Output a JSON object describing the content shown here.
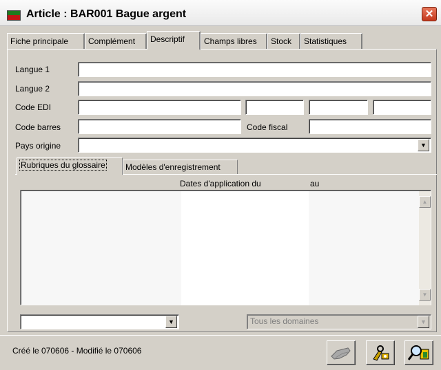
{
  "window": {
    "title": "Article : BAR001 Bague argent",
    "close_glyph": "✕"
  },
  "tabs": [
    {
      "label": "Fiche principale"
    },
    {
      "label": "Complément"
    },
    {
      "label": "Descriptif",
      "active": true
    },
    {
      "label": "Champs libres"
    },
    {
      "label": "Stock"
    },
    {
      "label": "Statistiques"
    }
  ],
  "form": {
    "langue1_label": "Langue 1",
    "langue1_value": "",
    "langue2_label": "Langue 2",
    "langue2_value": "",
    "code_edi_label": "Code EDI",
    "code_edi_values": [
      "",
      "",
      "",
      ""
    ],
    "code_barres_label": "Code barres",
    "code_barres_value": "",
    "code_fiscal_label": "Code fiscal",
    "code_fiscal_value": "",
    "pays_origine_label": "Pays origine",
    "pays_origine_value": ""
  },
  "inner_tabs": [
    {
      "label": "Rubriques du glossaire",
      "active": true
    },
    {
      "label": "Modèles d'enregistrement"
    }
  ],
  "list": {
    "col_dates": "Dates d'application du",
    "col_au": "au",
    "rows": []
  },
  "bottom": {
    "left_combo_value": "",
    "domain_combo_value": "Tous les domaines"
  },
  "status": {
    "text": "Créé le 070606 - Modifié le 070606"
  },
  "icons": {
    "app": "app-icon",
    "close": "close-icon",
    "dropdown": "▼",
    "scroll_up": "▲",
    "scroll_down": "▼"
  }
}
